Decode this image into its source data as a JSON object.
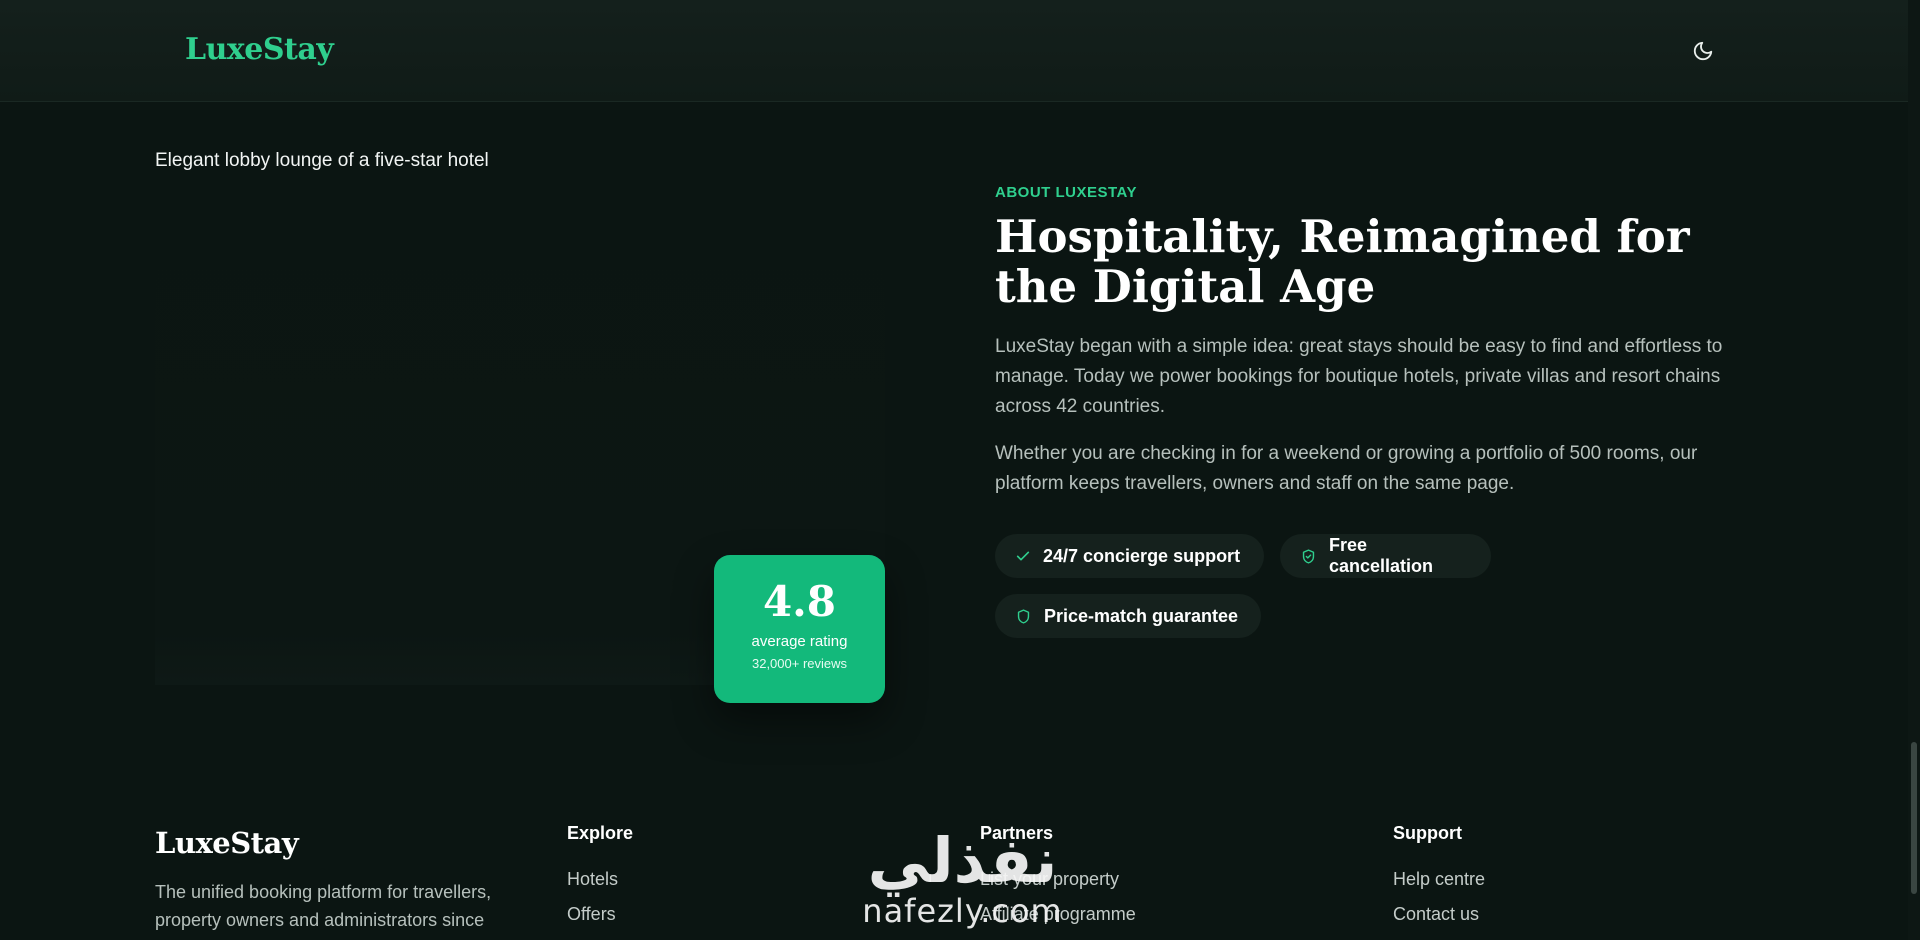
{
  "header": {
    "brand": "LuxeStay",
    "theme_icon": "moon-icon"
  },
  "about": {
    "image_alt": "Elegant lobby lounge of a five-star hotel",
    "rating": {
      "value": "4.8",
      "label": "average rating",
      "reviews": "32,000+ reviews"
    },
    "eyebrow": "ABOUT LUXESTAY",
    "headline": "Hospitality, Reimagined for the Digital Age",
    "paragraphs": [
      "LuxeStay began with a simple idea: great stays should be easy to find and effortless to manage. Today we power bookings for boutique hotels, private villas and resort chains across 42 countries.",
      "Whether you are checking in for a weekend or growing a portfolio of 500 rooms, our platform keeps travellers, owners and staff on the same page."
    ],
    "features": [
      {
        "label": "24/7 concierge support",
        "icon": "check-icon"
      },
      {
        "label": "Free cancellation",
        "icon": "shield-check-icon"
      },
      {
        "label": "Price-match guarantee",
        "icon": "shield-icon"
      }
    ]
  },
  "footer": {
    "brand": "LuxeStay",
    "tagline": "The unified booking platform for travellers, property owners and administrators since",
    "columns": [
      {
        "title": "Explore",
        "links": [
          "Hotels",
          "Offers"
        ]
      },
      {
        "title": "Partners",
        "links": [
          "List your property",
          "Affiliate programme"
        ]
      },
      {
        "title": "Support",
        "links": [
          "Help centre",
          "Contact us"
        ]
      }
    ]
  },
  "watermark": {
    "arabic": "نفذلي",
    "latin": "nafezly.com"
  },
  "colors": {
    "background": "#0b1512",
    "accent": "#2fcf8e",
    "rating_card": "#13b97b",
    "pill": "#15211d"
  }
}
